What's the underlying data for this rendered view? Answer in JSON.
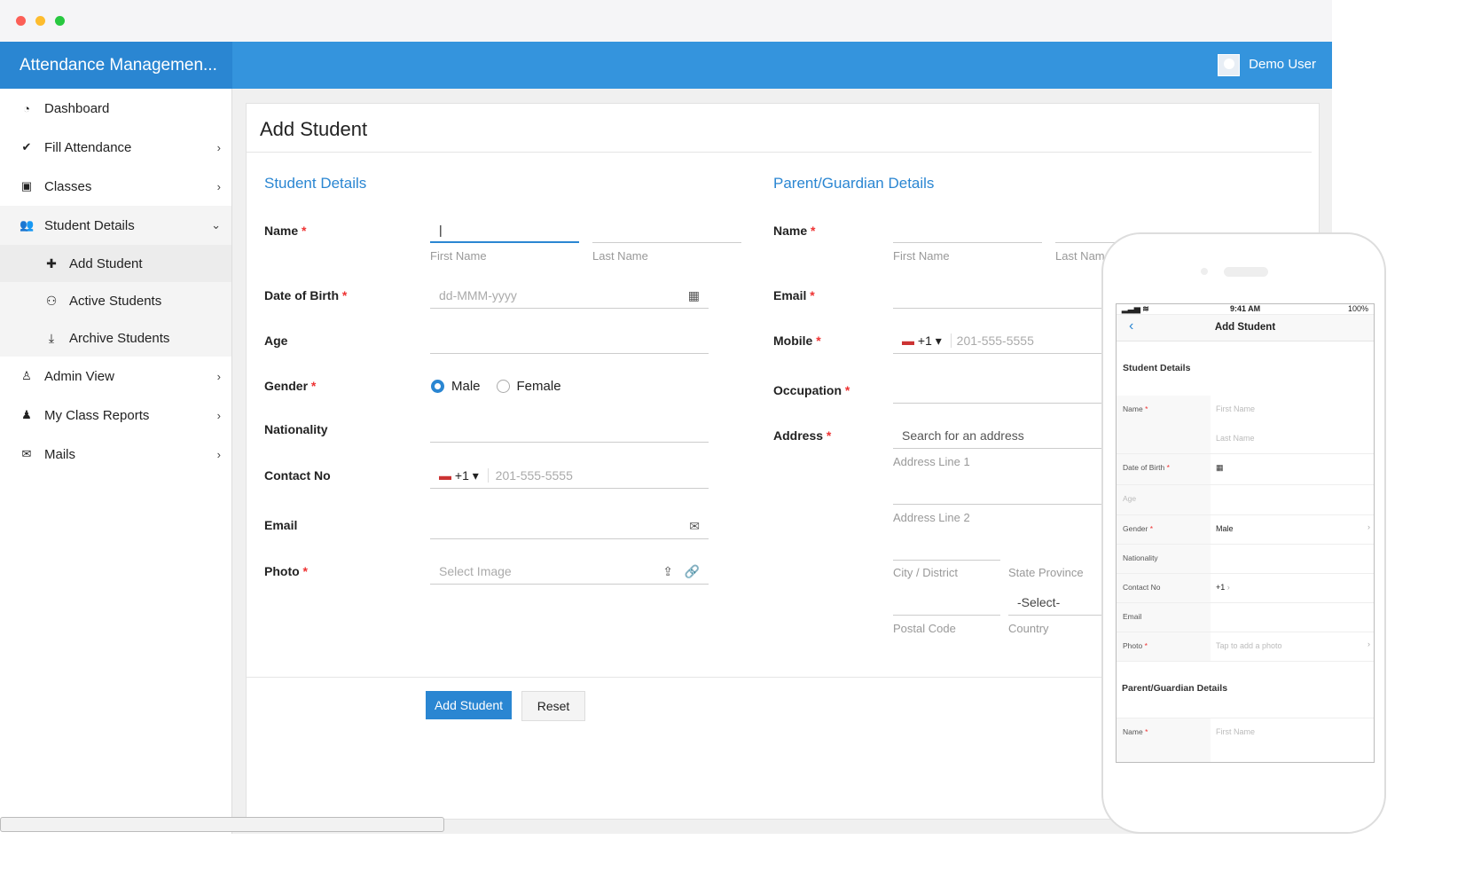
{
  "app": {
    "title": "Attendance Managemen...",
    "user": "Demo User"
  },
  "sidebar": {
    "items": [
      {
        "label": "Dashboard",
        "icon": "dashboard-icon"
      },
      {
        "label": "Fill Attendance",
        "icon": "check-circle-icon"
      },
      {
        "label": "Classes",
        "icon": "classes-icon"
      },
      {
        "label": "Student Details",
        "icon": "users-icon",
        "expanded": true,
        "sub": [
          {
            "label": "Add Student",
            "icon": "plus-icon",
            "active": true
          },
          {
            "label": "Active Students",
            "icon": "active-students-icon"
          },
          {
            "label": "Archive Students",
            "icon": "archive-icon"
          }
        ]
      },
      {
        "label": "Admin View",
        "icon": "admin-icon"
      },
      {
        "label": "My Class Reports",
        "icon": "reports-icon"
      },
      {
        "label": "Mails",
        "icon": "mail-icon"
      }
    ]
  },
  "form": {
    "title": "Add Student",
    "student": {
      "heading": "Student Details",
      "name": "Name",
      "first": "First Name",
      "last": "Last Name",
      "dob": "Date of Birth",
      "dob_ph": "dd-MMM-yyyy",
      "age": "Age",
      "gender": "Gender",
      "male": "Male",
      "female": "Female",
      "gender_value": "Male",
      "nationality": "Nationality",
      "contact": "Contact No",
      "code": "+1",
      "phone_ph": "201-555-5555",
      "email": "Email",
      "photo": "Photo",
      "photo_ph": "Select Image"
    },
    "parent": {
      "heading": "Parent/Guardian Details",
      "name": "Name",
      "first": "First Name",
      "last": "Last Name",
      "email": "Email",
      "mobile": "Mobile",
      "code": "+1",
      "phone_ph": "201-555-5555",
      "occupation": "Occupation",
      "address": "Address",
      "address_ph": "Search for an address",
      "line1": "Address Line 1",
      "line2": "Address Line 2",
      "city": "City / District",
      "state": "State Province",
      "select": "-Select-",
      "postal": "Postal Code",
      "country": "Country"
    },
    "submit": "Add Student",
    "reset": "Reset",
    "required_mark": "*"
  },
  "phone": {
    "time": "9:41 AM",
    "battery": "100%",
    "title": "Add Student",
    "student_heading": "Student Details",
    "name": "Name",
    "first": "First Name",
    "last": "Last Name",
    "dob": "Date of Birth",
    "age": "Age",
    "gender": "Gender",
    "gender_value": "Male",
    "nationality": "Nationality",
    "contact": "Contact No",
    "code": "+1",
    "email": "Email",
    "photo": "Photo",
    "photo_ph": "Tap to add a photo",
    "parent_heading": "Parent/Guardian Details",
    "pname": "Name",
    "pfirst": "First Name"
  },
  "colors": {
    "header": "#3494dd",
    "accent": "#2a86d2",
    "required": "#e33"
  }
}
